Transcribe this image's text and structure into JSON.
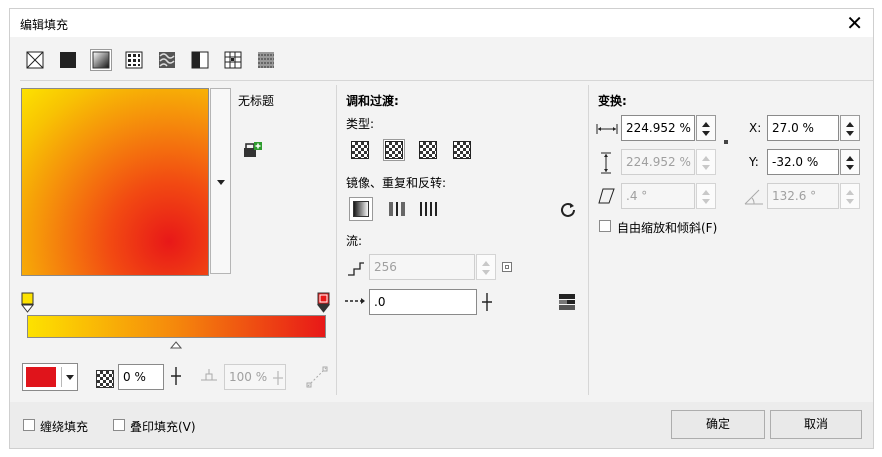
{
  "dialog": {
    "title": "编辑填充",
    "close_icon": "close-icon"
  },
  "fill_types": [
    {
      "name": "no-fill",
      "selected": false
    },
    {
      "name": "uniform-fill",
      "selected": false
    },
    {
      "name": "fountain-fill",
      "selected": true
    },
    {
      "name": "vector-pattern-fill",
      "selected": false
    },
    {
      "name": "bitmap-pattern-fill",
      "selected": false
    },
    {
      "name": "two-color-pattern-fill",
      "selected": false
    },
    {
      "name": "texture-fill",
      "selected": false
    },
    {
      "name": "postscript-fill",
      "selected": false
    }
  ],
  "preview": {
    "name": "无标题"
  },
  "blend": {
    "heading": "调和过渡:",
    "type_label": "类型:",
    "mirror_label": "镜像、重复和反转:",
    "flow_label": "流:",
    "steps_value": "256",
    "accel_value": ".0"
  },
  "transform": {
    "heading": "变换:",
    "width_value": "224.952 %",
    "height_value": "224.952 %",
    "x_label": "X:",
    "x_value": "27.0 %",
    "y_label": "Y:",
    "y_value": "-32.0 %",
    "skew_value": ".4 °",
    "rotate_value": "132.6 °",
    "free_scale_label": "自由缩放和倾斜(F)"
  },
  "nodes": {
    "color": "#e0141b",
    "transparency_value": "0 %",
    "position_value": "100 %"
  },
  "colors": {
    "start": "#fde200",
    "end": "#e81818"
  },
  "footer": {
    "wrap_fill_label": "缠绕填充",
    "overprint_label": "叠印填充(V)",
    "ok_label": "确定",
    "cancel_label": "取消"
  }
}
